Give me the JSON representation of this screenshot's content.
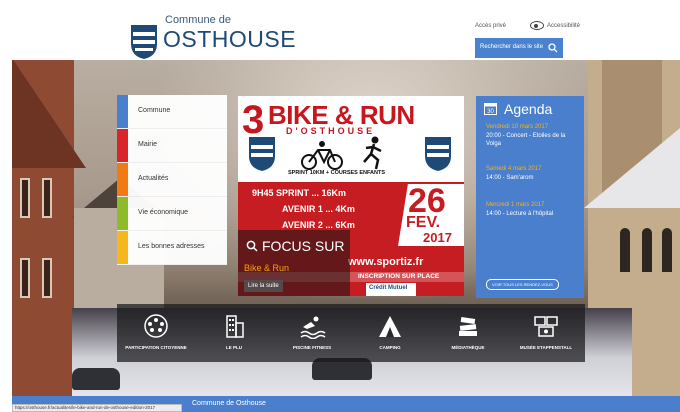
{
  "header": {
    "logo_small": "Commune de",
    "logo_big": "OSTHOUSE",
    "private_access": "Accès privé",
    "accessibility": "Accessibilité",
    "search_placeholder": "Rechercher dans le site"
  },
  "nav": {
    "items": [
      {
        "label": "Commune",
        "color": "#4a7fcd"
      },
      {
        "label": "Mairie",
        "color": "#d9242a"
      },
      {
        "label": "Actualités",
        "color": "#f27a12"
      },
      {
        "label": "Vie économique",
        "color": "#8dbb2a"
      },
      {
        "label": "Les bonnes adresses",
        "color": "#f5b71c"
      }
    ]
  },
  "poster": {
    "title": "BIKE & RUN",
    "number": "3",
    "subtitle": "D'OSTHOUSE",
    "sprint_line": "SPRINT 10KM + COURSES ENFANTS",
    "row1": "9H45  SPRINT ... 16Km",
    "row2": "AVENIR 1 ... 4Km",
    "row3": "AVENIR 2 ... 6Km",
    "day": "26",
    "month": "FEV.",
    "year": "2017",
    "website": "www.sportiz.fr",
    "inscription": "INSCRIPTION SUR PLACE",
    "sponsor": "Crédit Mutuel"
  },
  "focus": {
    "title": "FOCUS SUR",
    "subtitle": "Bike & Run",
    "more": "Lire la suite"
  },
  "agenda": {
    "title": "Agenda",
    "events": [
      {
        "date": "Vendredi 10 mars 2017",
        "desc": "20:00 - Concert - Etoiles de la Volga"
      },
      {
        "date": "Samedi 4 mars 2017",
        "desc": "14:00 - Sam'arom"
      },
      {
        "date": "Mercredi 1 mars 2017",
        "desc": "14:00 - Lecture à l'hôpital"
      }
    ],
    "all_button": "VOIR TOUS LES RENDEZ-VOUS"
  },
  "quick_access": [
    {
      "label": "PARTICIPATION CITOYENNE",
      "icon": "people-circle-icon"
    },
    {
      "label": "LE PLU",
      "icon": "buildings-icon"
    },
    {
      "label": "PISCINE FITNESS",
      "icon": "swimmer-icon"
    },
    {
      "label": "CAMPING",
      "icon": "tent-icon"
    },
    {
      "label": "MÉDIATHÈQUE",
      "icon": "books-icon"
    },
    {
      "label": "MUSÉE ETAPPENSTALL",
      "icon": "museum-icon"
    }
  ],
  "footer": {
    "text": "Commune de Osthouse",
    "status_url": "https://osthouse.fr/actualites/le-bike-and-run-de-osthouse-edition-2017"
  },
  "colors": {
    "brand_blue": "#4a7fcd",
    "logo_blue": "#1e4a75",
    "poster_red": "#c51d22",
    "accent_orange": "#f2a20c"
  }
}
